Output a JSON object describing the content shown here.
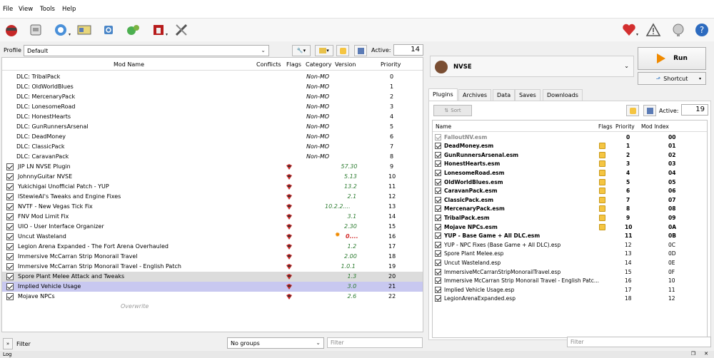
{
  "menu": [
    "File",
    "View",
    "Tools",
    "Help"
  ],
  "toolbar": {
    "icons": [
      "install-mod-icon",
      "nexus-icon",
      "browser-icon",
      "profiles-icon",
      "refresh-icon",
      "settings-gear-icon",
      "executables-icon",
      "tools-icon",
      "endorse-heart-icon",
      "warning-icon",
      "notifications-icon",
      "help-icon"
    ]
  },
  "profile": {
    "label": "Profile",
    "value": "Default"
  },
  "active": {
    "label": "Active:",
    "value": "14"
  },
  "modlist": {
    "headers": {
      "name": "Mod Name",
      "conflicts": "Conflicts",
      "flags": "Flags",
      "category": "Category",
      "version": "Version",
      "priority": "Priority"
    },
    "rows": [
      {
        "name": "DLC: TribalPack",
        "category": "Non-MO",
        "version": "",
        "priority": "0",
        "checkbox": false,
        "flag": false
      },
      {
        "name": "DLC: OldWorldBlues",
        "category": "Non-MO",
        "version": "",
        "priority": "1",
        "checkbox": false,
        "flag": false
      },
      {
        "name": "DLC: MercenaryPack",
        "category": "Non-MO",
        "version": "",
        "priority": "2",
        "checkbox": false,
        "flag": false
      },
      {
        "name": "DLC: LonesomeRoad",
        "category": "Non-MO",
        "version": "",
        "priority": "3",
        "checkbox": false,
        "flag": false
      },
      {
        "name": "DLC: HonestHearts",
        "category": "Non-MO",
        "version": "",
        "priority": "4",
        "checkbox": false,
        "flag": false
      },
      {
        "name": "DLC: GunRunnersArsenal",
        "category": "Non-MO",
        "version": "",
        "priority": "5",
        "checkbox": false,
        "flag": false
      },
      {
        "name": "DLC: DeadMoney",
        "category": "Non-MO",
        "version": "",
        "priority": "6",
        "checkbox": false,
        "flag": false
      },
      {
        "name": "DLC: ClassicPack",
        "category": "Non-MO",
        "version": "",
        "priority": "7",
        "checkbox": false,
        "flag": false
      },
      {
        "name": "DLC: CaravanPack",
        "category": "Non-MO",
        "version": "",
        "priority": "8",
        "checkbox": false,
        "flag": false
      },
      {
        "name": "JIP LN NVSE Plugin",
        "category": "",
        "version": "57.30",
        "priority": "9",
        "checkbox": true,
        "flag": true
      },
      {
        "name": "JohnnyGuitar NVSE",
        "category": "",
        "version": "5.13",
        "priority": "10",
        "checkbox": true,
        "flag": true
      },
      {
        "name": "Yukichigai Unofficial Patch - YUP",
        "category": "",
        "version": "13.2",
        "priority": "11",
        "checkbox": true,
        "flag": true
      },
      {
        "name": "lStewieAl's Tweaks and Engine Fixes",
        "category": "",
        "version": "2.1",
        "priority": "12",
        "checkbox": true,
        "flag": true
      },
      {
        "name": "NVTF - New Vegas Tick Fix",
        "category": "",
        "version": "10.2.2....",
        "priority": "13",
        "checkbox": true,
        "flag": true
      },
      {
        "name": "FNV Mod Limit Fix",
        "category": "",
        "version": "3.1",
        "priority": "14",
        "checkbox": true,
        "flag": true
      },
      {
        "name": "UIO - User Interface Organizer",
        "category": "",
        "version": "2.30",
        "priority": "15",
        "checkbox": true,
        "flag": true
      },
      {
        "name": "Uncut Wasteland",
        "category": "",
        "version": "0....",
        "priority": "16",
        "checkbox": true,
        "flag": true,
        "warn": true
      },
      {
        "name": "Legion Arena Expanded - The Fort Arena Overhauled",
        "category": "",
        "version": "1.2",
        "priority": "17",
        "checkbox": true,
        "flag": true
      },
      {
        "name": "Immersive McCarran Strip Monorail Travel",
        "category": "",
        "version": "2.00",
        "priority": "18",
        "checkbox": true,
        "flag": true
      },
      {
        "name": "Immersive McCarran Strip Monorail Travel - English Patch",
        "category": "",
        "version": "1.0.1",
        "priority": "19",
        "checkbox": true,
        "flag": true
      },
      {
        "name": "Spore Plant Melee Attack and Tweaks",
        "category": "",
        "version": "1.3",
        "priority": "20",
        "checkbox": true,
        "flag": true,
        "shade": "#dcdcdc"
      },
      {
        "name": "Implied Vehicle Usage",
        "category": "",
        "version": "3.0",
        "priority": "21",
        "checkbox": true,
        "flag": true,
        "shade": "#c8c8f0"
      },
      {
        "name": "Mojave NPCs",
        "category": "",
        "version": "2.6",
        "priority": "22",
        "checkbox": true,
        "flag": true
      }
    ],
    "overwrite": "Overwrite"
  },
  "left_bottom": {
    "filter_label": "Filter",
    "groups_value": "No groups",
    "filter_placeholder": "Filter"
  },
  "executable": {
    "name": "NVSE"
  },
  "run": {
    "label": "Run",
    "shortcut": "Shortcut"
  },
  "tabs": [
    "Plugins",
    "Archives",
    "Data",
    "Saves",
    "Downloads"
  ],
  "sort_label": "Sort",
  "plugins_active": {
    "label": "Active:",
    "value": "19"
  },
  "plugins": {
    "headers": {
      "name": "Name",
      "flags": "Flags",
      "priority": "Priority",
      "modindex": "Mod Index"
    },
    "rows": [
      {
        "name": "FalloutNV.esm",
        "priority": "0",
        "index": "00",
        "bold": true,
        "gray": true,
        "flag": false
      },
      {
        "name": "DeadMoney.esm",
        "priority": "1",
        "index": "01",
        "bold": true,
        "flag": true
      },
      {
        "name": "GunRunnersArsenal.esm",
        "priority": "2",
        "index": "02",
        "bold": true,
        "flag": true
      },
      {
        "name": "HonestHearts.esm",
        "priority": "3",
        "index": "03",
        "bold": true,
        "flag": true
      },
      {
        "name": "LonesomeRoad.esm",
        "priority": "4",
        "index": "04",
        "bold": true,
        "flag": true
      },
      {
        "name": "OldWorldBlues.esm",
        "priority": "5",
        "index": "05",
        "bold": true,
        "flag": true
      },
      {
        "name": "CaravanPack.esm",
        "priority": "6",
        "index": "06",
        "bold": true,
        "flag": true
      },
      {
        "name": "ClassicPack.esm",
        "priority": "7",
        "index": "07",
        "bold": true,
        "flag": true
      },
      {
        "name": "MercenaryPack.esm",
        "priority": "8",
        "index": "08",
        "bold": true,
        "flag": true
      },
      {
        "name": "TribalPack.esm",
        "priority": "9",
        "index": "09",
        "bold": true,
        "flag": true
      },
      {
        "name": "Mojave NPCs.esm",
        "priority": "10",
        "index": "0A",
        "bold": true,
        "flag": true
      },
      {
        "name": "YUP - Base Game + All DLC.esm",
        "priority": "11",
        "index": "0B",
        "bold": true,
        "flag": false
      },
      {
        "name": "YUP - NPC Fixes (Base Game + All DLC).esp",
        "priority": "12",
        "index": "0C",
        "bold": false,
        "flag": false
      },
      {
        "name": "Spore Plant Melee.esp",
        "priority": "13",
        "index": "0D",
        "bold": false,
        "flag": false
      },
      {
        "name": "Uncut Wasteland.esp",
        "priority": "14",
        "index": "0E",
        "bold": false,
        "flag": false
      },
      {
        "name": "ImmersiveMcCarranStripMonorailTravel.esp",
        "priority": "15",
        "index": "0F",
        "bold": false,
        "flag": false
      },
      {
        "name": "Immersive McCarran Strip Monorail Travel - English Patc...",
        "priority": "16",
        "index": "10",
        "bold": false,
        "flag": false
      },
      {
        "name": "Implied Vehicle Usage.esp",
        "priority": "17",
        "index": "11",
        "bold": false,
        "flag": false
      },
      {
        "name": "LegionArenaExpanded.esp",
        "priority": "18",
        "index": "12",
        "bold": false,
        "flag": false
      }
    ]
  },
  "right_bottom": {
    "filter_placeholder": "Filter"
  },
  "status": {
    "log_label": "Log"
  },
  "colors": {
    "accent": "#f08a00",
    "selection": "#c8c8f0",
    "version_green": "#2e7d32"
  }
}
